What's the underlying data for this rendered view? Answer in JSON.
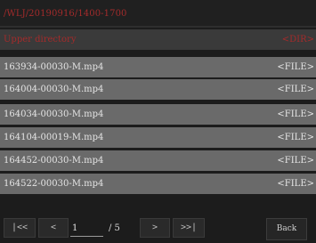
{
  "path": "/WLJ/20190916/1400-1700",
  "parent_entry": {
    "name": "Upper directory",
    "kind": "<DIR>"
  },
  "files": [
    {
      "name": "163934-00030-M.mp4",
      "kind": "<FILE>"
    },
    {
      "name": "164004-00030-M.mp4",
      "kind": "<FILE>"
    },
    {
      "name": "164034-00030-M.mp4",
      "kind": "<FILE>"
    },
    {
      "name": "164104-00019-M.mp4",
      "kind": "<FILE>"
    },
    {
      "name": "164452-00030-M.mp4",
      "kind": "<FILE>"
    },
    {
      "name": "164522-00030-M.mp4",
      "kind": "<FILE>"
    }
  ],
  "pager": {
    "first_label": "|<<",
    "prev_label": "<",
    "current_page": "1",
    "total_label": "/ 5",
    "next_label": ">",
    "last_label": ">>|"
  },
  "back_label": "Back",
  "colors": {
    "accent_red": "#a32b2b",
    "row_bg": "#6a6a6a",
    "page_bg": "#1c1c1c"
  }
}
